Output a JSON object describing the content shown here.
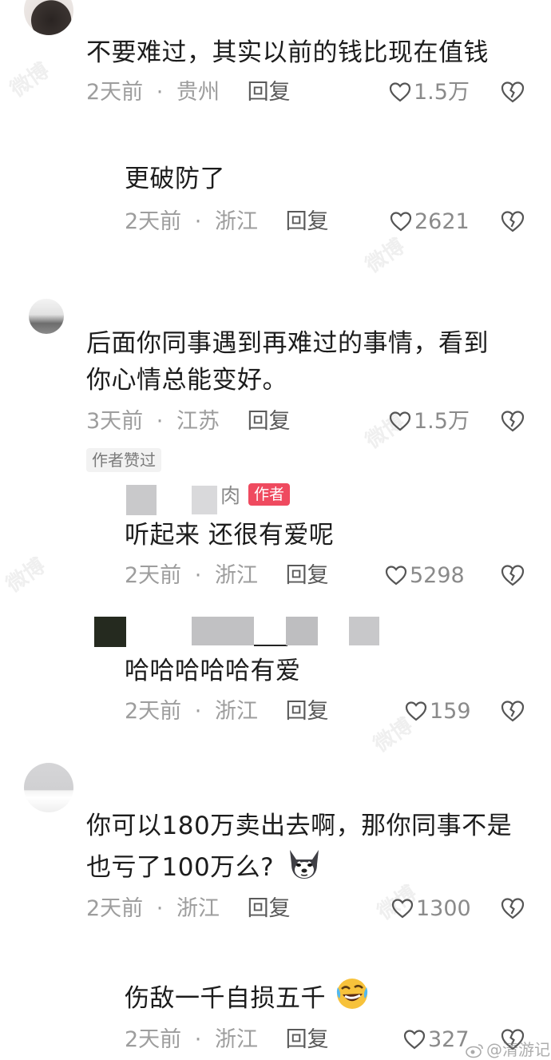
{
  "comments": [
    {
      "text": "不要难过，其实以前的钱比现在值钱",
      "time": "2天前",
      "location": "贵州",
      "reply": "回复",
      "likes": "1.5万"
    },
    {
      "text": "更破防了",
      "time": "2天前",
      "location": "浙江",
      "reply": "回复",
      "likes": "2621"
    },
    {
      "line1": "后面你同事遇到再难过的事情，看到",
      "line2": "你心情总能变好。",
      "time": "3天前",
      "location": "江苏",
      "reply": "回复",
      "likes": "1.5万",
      "badge": "作者赞过"
    },
    {
      "author_name_visible": "肉",
      "author_tag": "作者",
      "text": "听起来 还很有爱呢",
      "time": "2天前",
      "location": "浙江",
      "reply": "回复",
      "likes": "5298"
    },
    {
      "text": "哈哈哈哈哈有爱",
      "time": "2天前",
      "location": "浙江",
      "reply": "回复",
      "likes": "159"
    },
    {
      "line1": "你可以180万卖出去啊，那你同事不是",
      "line2": "也亏了100万么?",
      "time": "2天前",
      "location": "浙江",
      "reply": "回复",
      "likes": "1300"
    },
    {
      "text": "伤敌一千自损五千",
      "time": "2天前",
      "location": "浙江",
      "reply": "回复",
      "likes": "327"
    }
  ],
  "separator": "·",
  "watermark": "微博",
  "footer_watermark": "@清游记",
  "colors": {
    "author_tag": "#ef4a5f",
    "meta": "#9d9d9d",
    "text": "#1c1c1c"
  },
  "icons": {
    "like": "heart-outline-icon",
    "dislike": "broken-heart-icon"
  }
}
